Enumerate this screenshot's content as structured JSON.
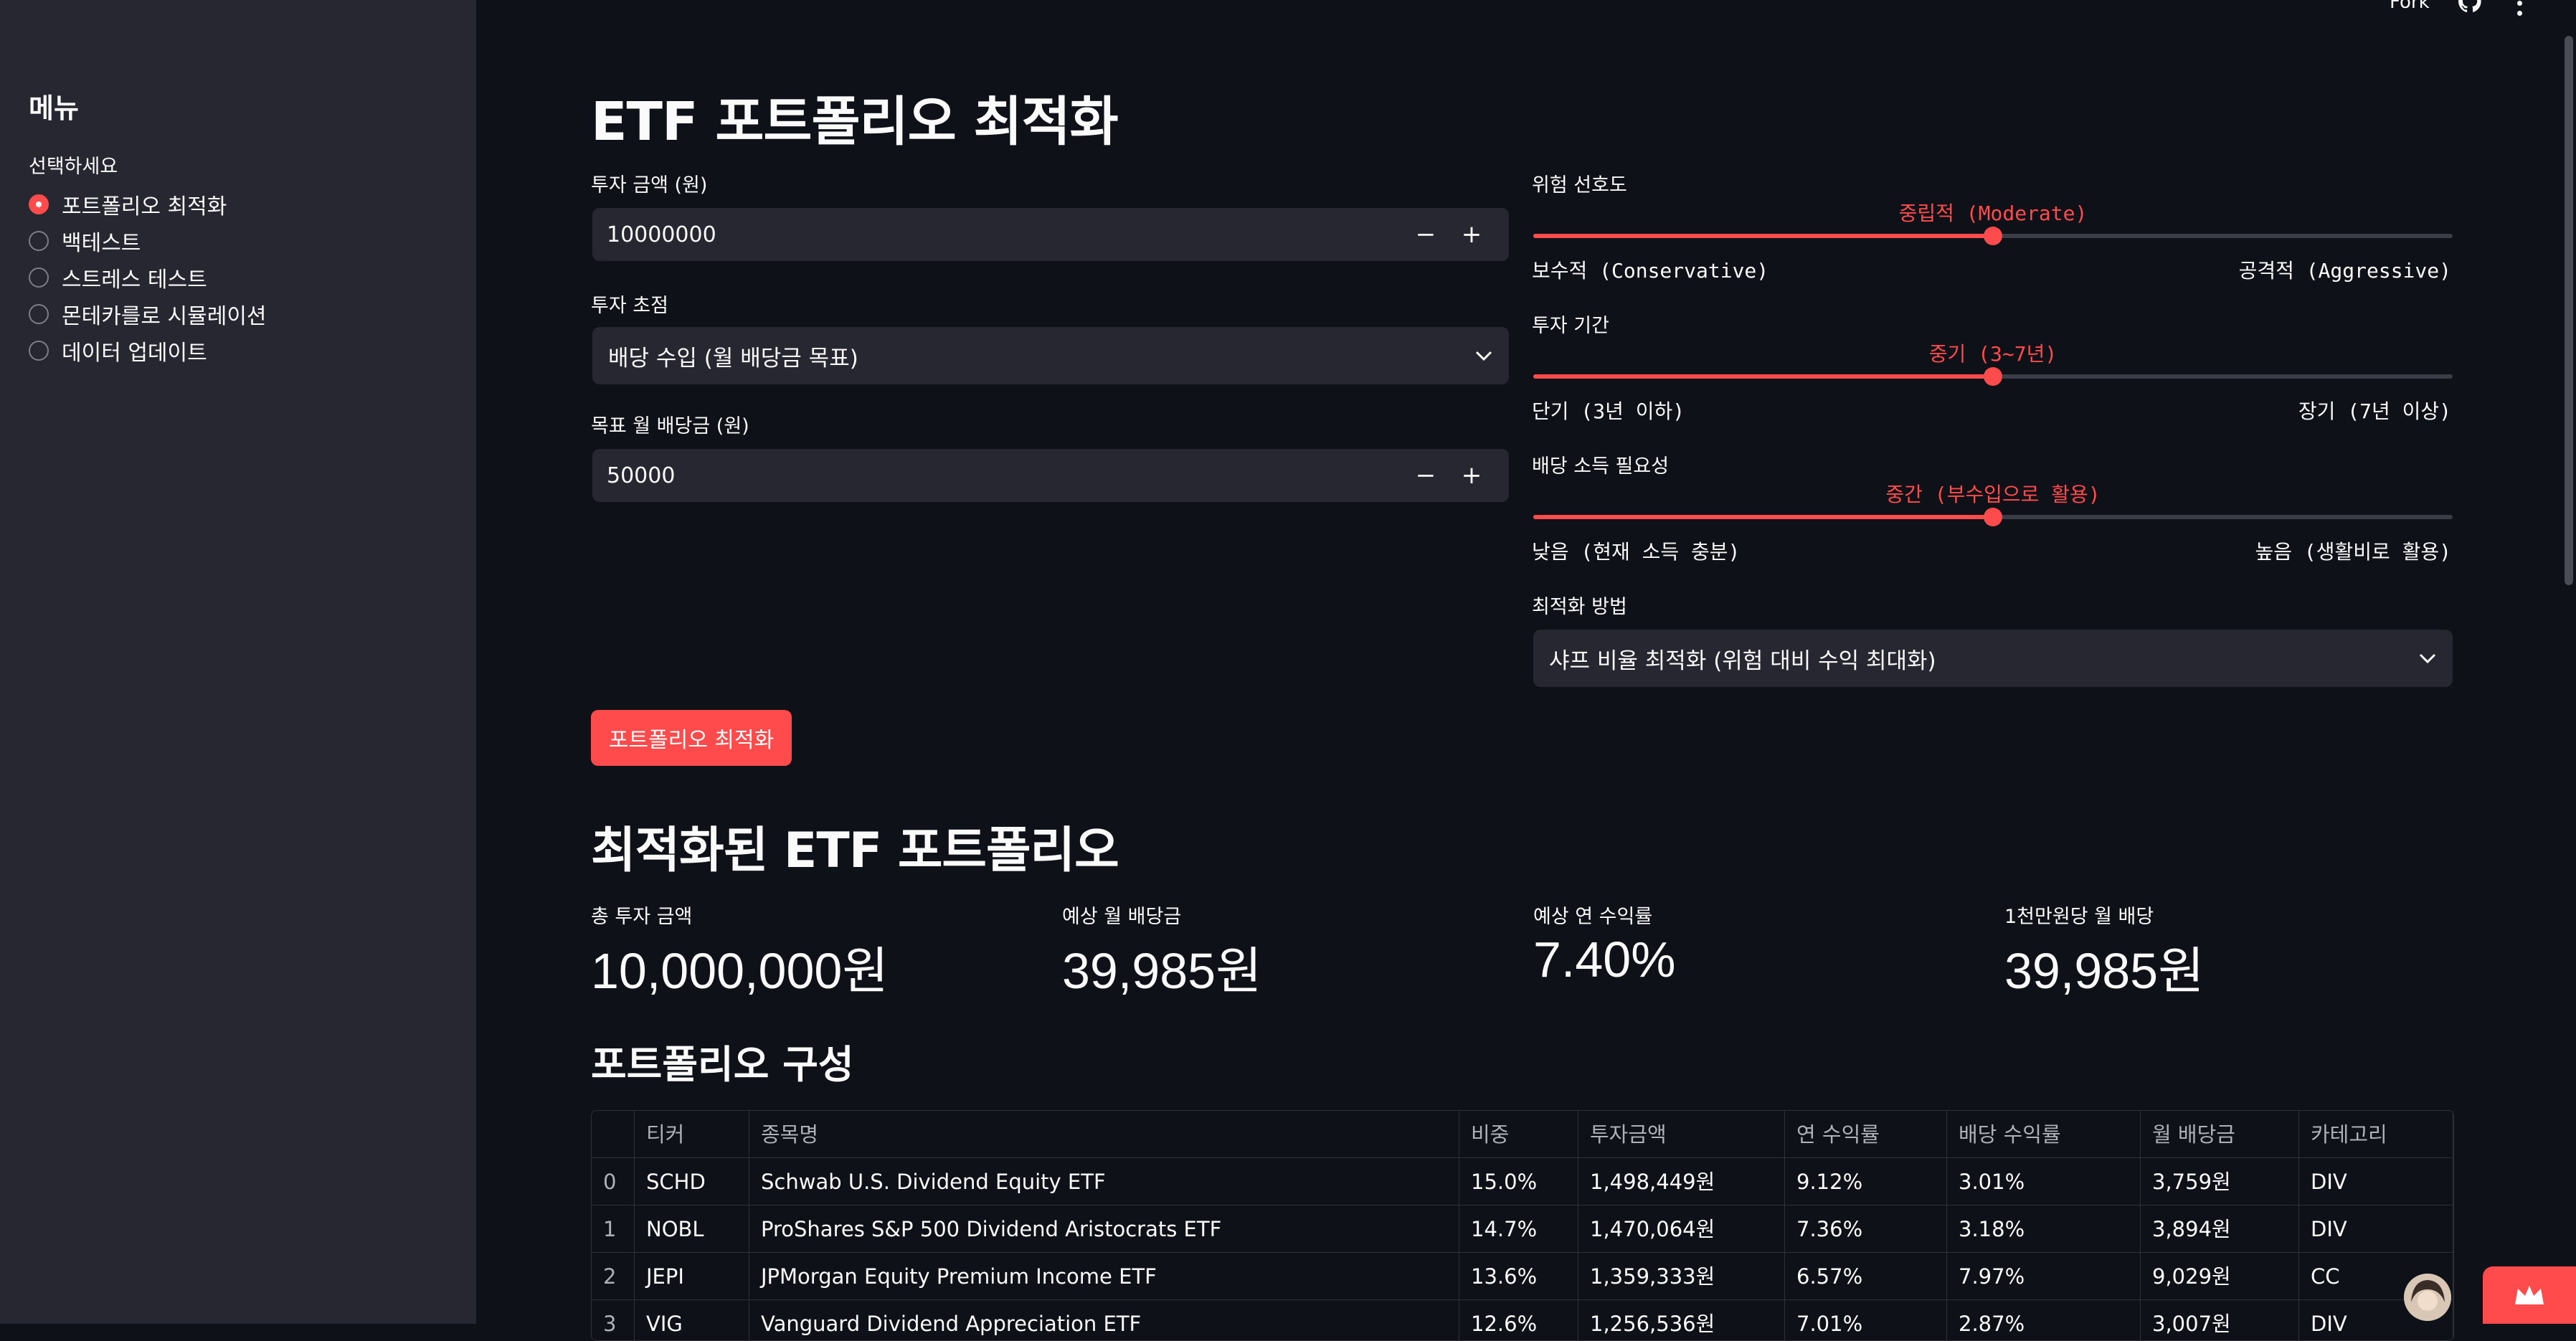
{
  "topbar": {
    "fork_label": "Fork",
    "github_icon": "github-icon",
    "menu_icon": "more-vertical-icon"
  },
  "sidebar": {
    "title": "메뉴",
    "radio_label": "선택하세요",
    "items": [
      {
        "label": "포트폴리오 최적화",
        "selected": true
      },
      {
        "label": "백테스트",
        "selected": false
      },
      {
        "label": "스트레스 테스트",
        "selected": false
      },
      {
        "label": "몬테카를로 시뮬레이션",
        "selected": false
      },
      {
        "label": "데이터 업데이트",
        "selected": false
      }
    ]
  },
  "main": {
    "title": "ETF 포트폴리오 최적화",
    "investment_amount": {
      "label": "투자 금액 (원)",
      "value": "10000000"
    },
    "investment_focus": {
      "label": "투자 초점",
      "value": "배당 수입 (월 배당금 목표)"
    },
    "target_dividend": {
      "label": "목표 월 배당금 (원)",
      "value": "50000"
    },
    "risk": {
      "label": "위험 선호도",
      "value": "중립적 (Moderate)",
      "min": "보수적 (Conservative)",
      "max": "공격적 (Aggressive)",
      "level": 0.5
    },
    "horizon": {
      "label": "투자 기간",
      "value": "중기 (3~7년)",
      "min": "단기 (3년 이하)",
      "max": "장기 (7년 이상)",
      "level": 0.5
    },
    "dividend_need": {
      "label": "배당 소득 필요성",
      "value": "중간 (부수입으로 활용)",
      "min": "낮음 (현재 소득 충분)",
      "max": "높음 (생활비로 활용)",
      "level": 0.5
    },
    "method": {
      "label": "최적화 방법",
      "value": "샤프 비율 최적화 (위험 대비 수익 최대화)"
    },
    "optimize_button": "포트폴리오 최적화",
    "results_title": "최적화된 ETF 포트폴리오",
    "metrics": [
      {
        "label": "총 투자 금액",
        "value": "10,000,000원"
      },
      {
        "label": "예상 월 배당금",
        "value": "39,985원"
      },
      {
        "label": "예상 연 수익률",
        "value": "7.40%"
      },
      {
        "label": "1천만원당 월 배당",
        "value": "39,985원"
      }
    ],
    "composition_title": "포트폴리오 구성",
    "table": {
      "columns": [
        "",
        "티커",
        "종목명",
        "비중",
        "투자금액",
        "연 수익률",
        "배당 수익률",
        "월 배당금",
        "카테고리"
      ],
      "rows": [
        [
          "0",
          "SCHD",
          "Schwab U.S. Dividend Equity ETF",
          "15.0%",
          "1,498,449원",
          "9.12%",
          "3.01%",
          "3,759원",
          "DIV"
        ],
        [
          "1",
          "NOBL",
          "ProShares S&P 500 Dividend Aristocrats ETF",
          "14.7%",
          "1,470,064원",
          "7.36%",
          "3.18%",
          "3,894원",
          "DIV"
        ],
        [
          "2",
          "JEPI",
          "JPMorgan Equity Premium Income ETF",
          "13.6%",
          "1,359,333원",
          "6.57%",
          "7.97%",
          "9,029원",
          "CC"
        ],
        [
          "3",
          "VIG",
          "Vanguard Dividend Appreciation ETF",
          "12.6%",
          "1,256,536원",
          "7.01%",
          "2.87%",
          "3,007원",
          "DIV"
        ]
      ]
    }
  },
  "colors": {
    "accent": "#ff4b4b",
    "background": "#0e1117",
    "sidebar": "#262730",
    "input": "#262730"
  }
}
